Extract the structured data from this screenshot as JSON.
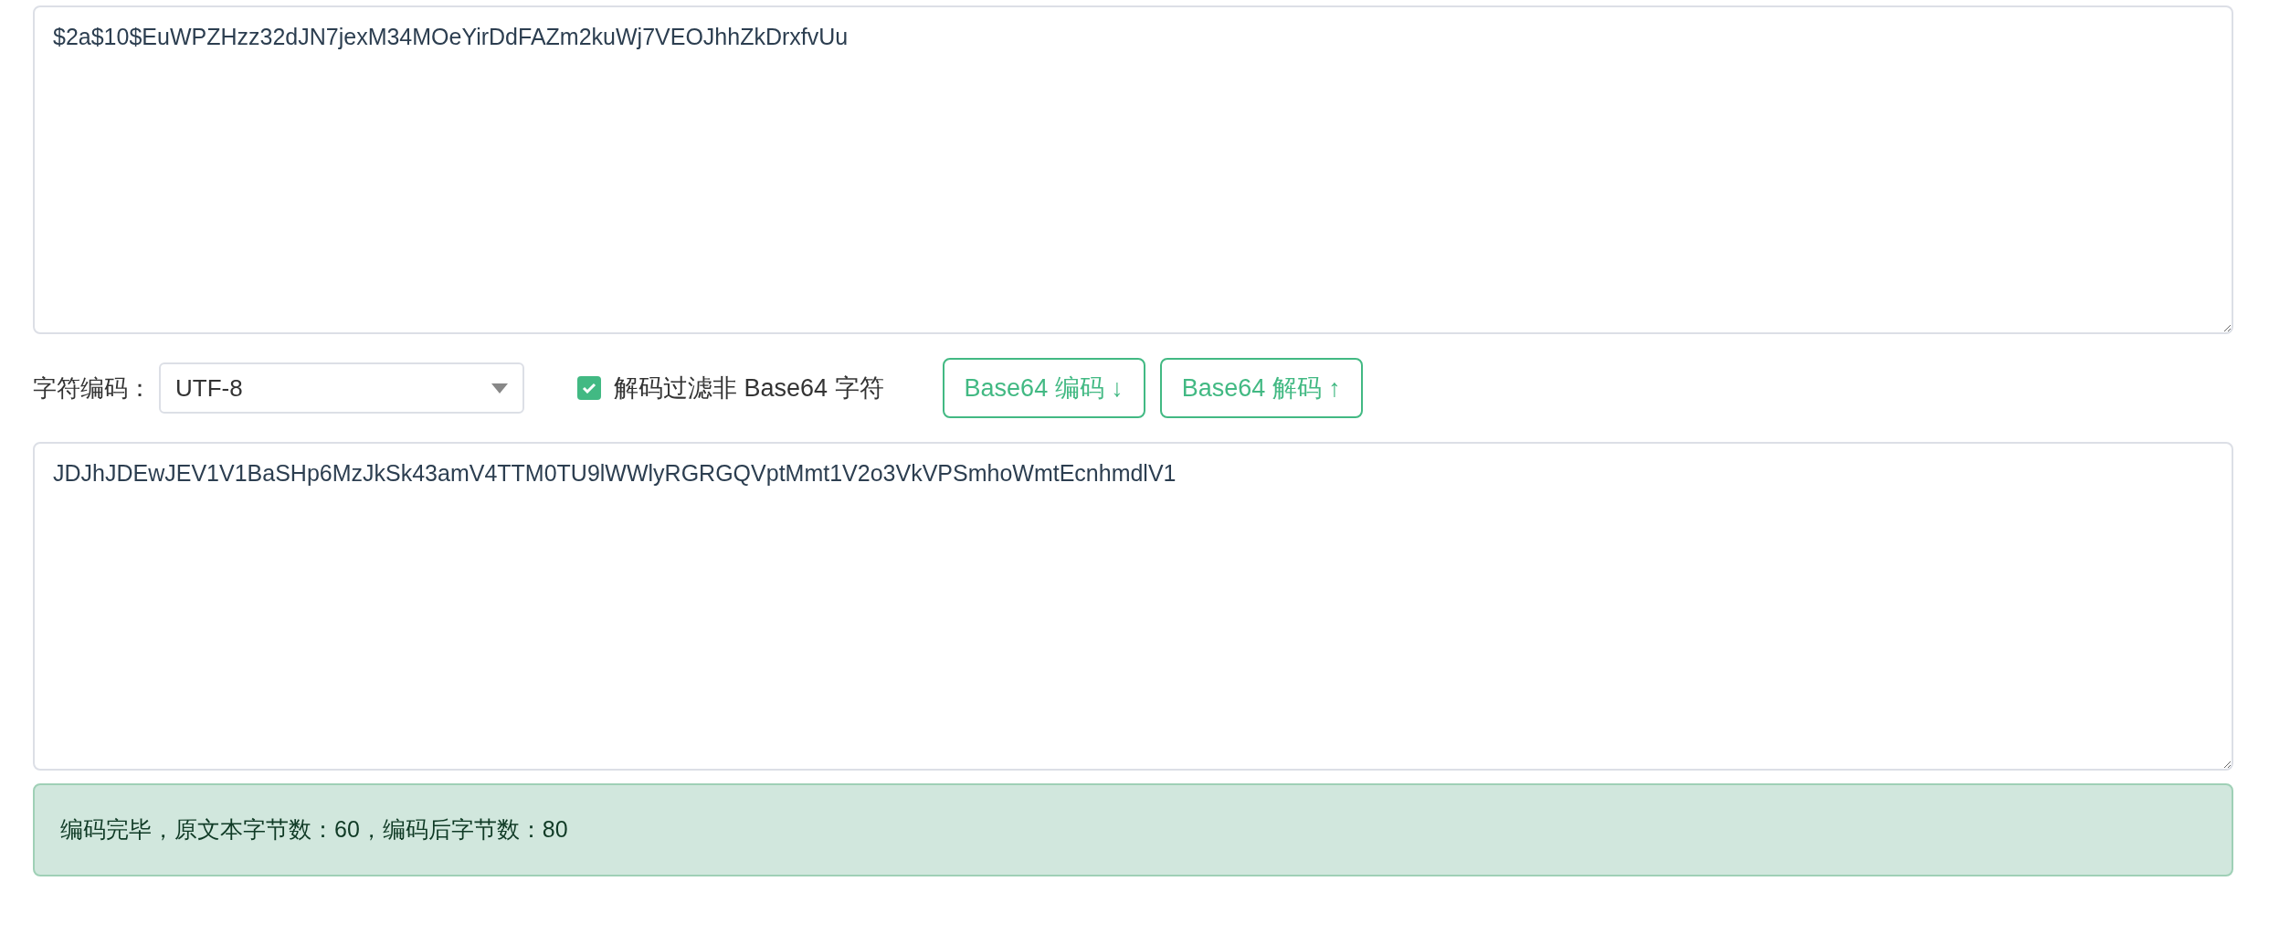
{
  "input_text": "$2a$10$EuWPZHzz32dJN7jexM34MOeYirDdFAZm2kuWj7VEOJhhZkDrxfvUu",
  "charset": {
    "label": "字符编码：",
    "value": "UTF-8"
  },
  "filter_option": {
    "label": "解码过滤非 Base64 字符",
    "checked": true
  },
  "buttons": [
    {
      "label": "Base64 编码 ↓"
    },
    {
      "label": "Base64 解码 ↑"
    }
  ],
  "output_text": "JDJhJDEwJEV1V1BaSHp6MzJkSk43amV4TTM0TU9lWWlyRGRGQVptMmt1V2o3VkVPSmhoWmtEcnhmdlV1",
  "status_message": "编码完毕，原文本字节数：60，编码后字节数：80"
}
